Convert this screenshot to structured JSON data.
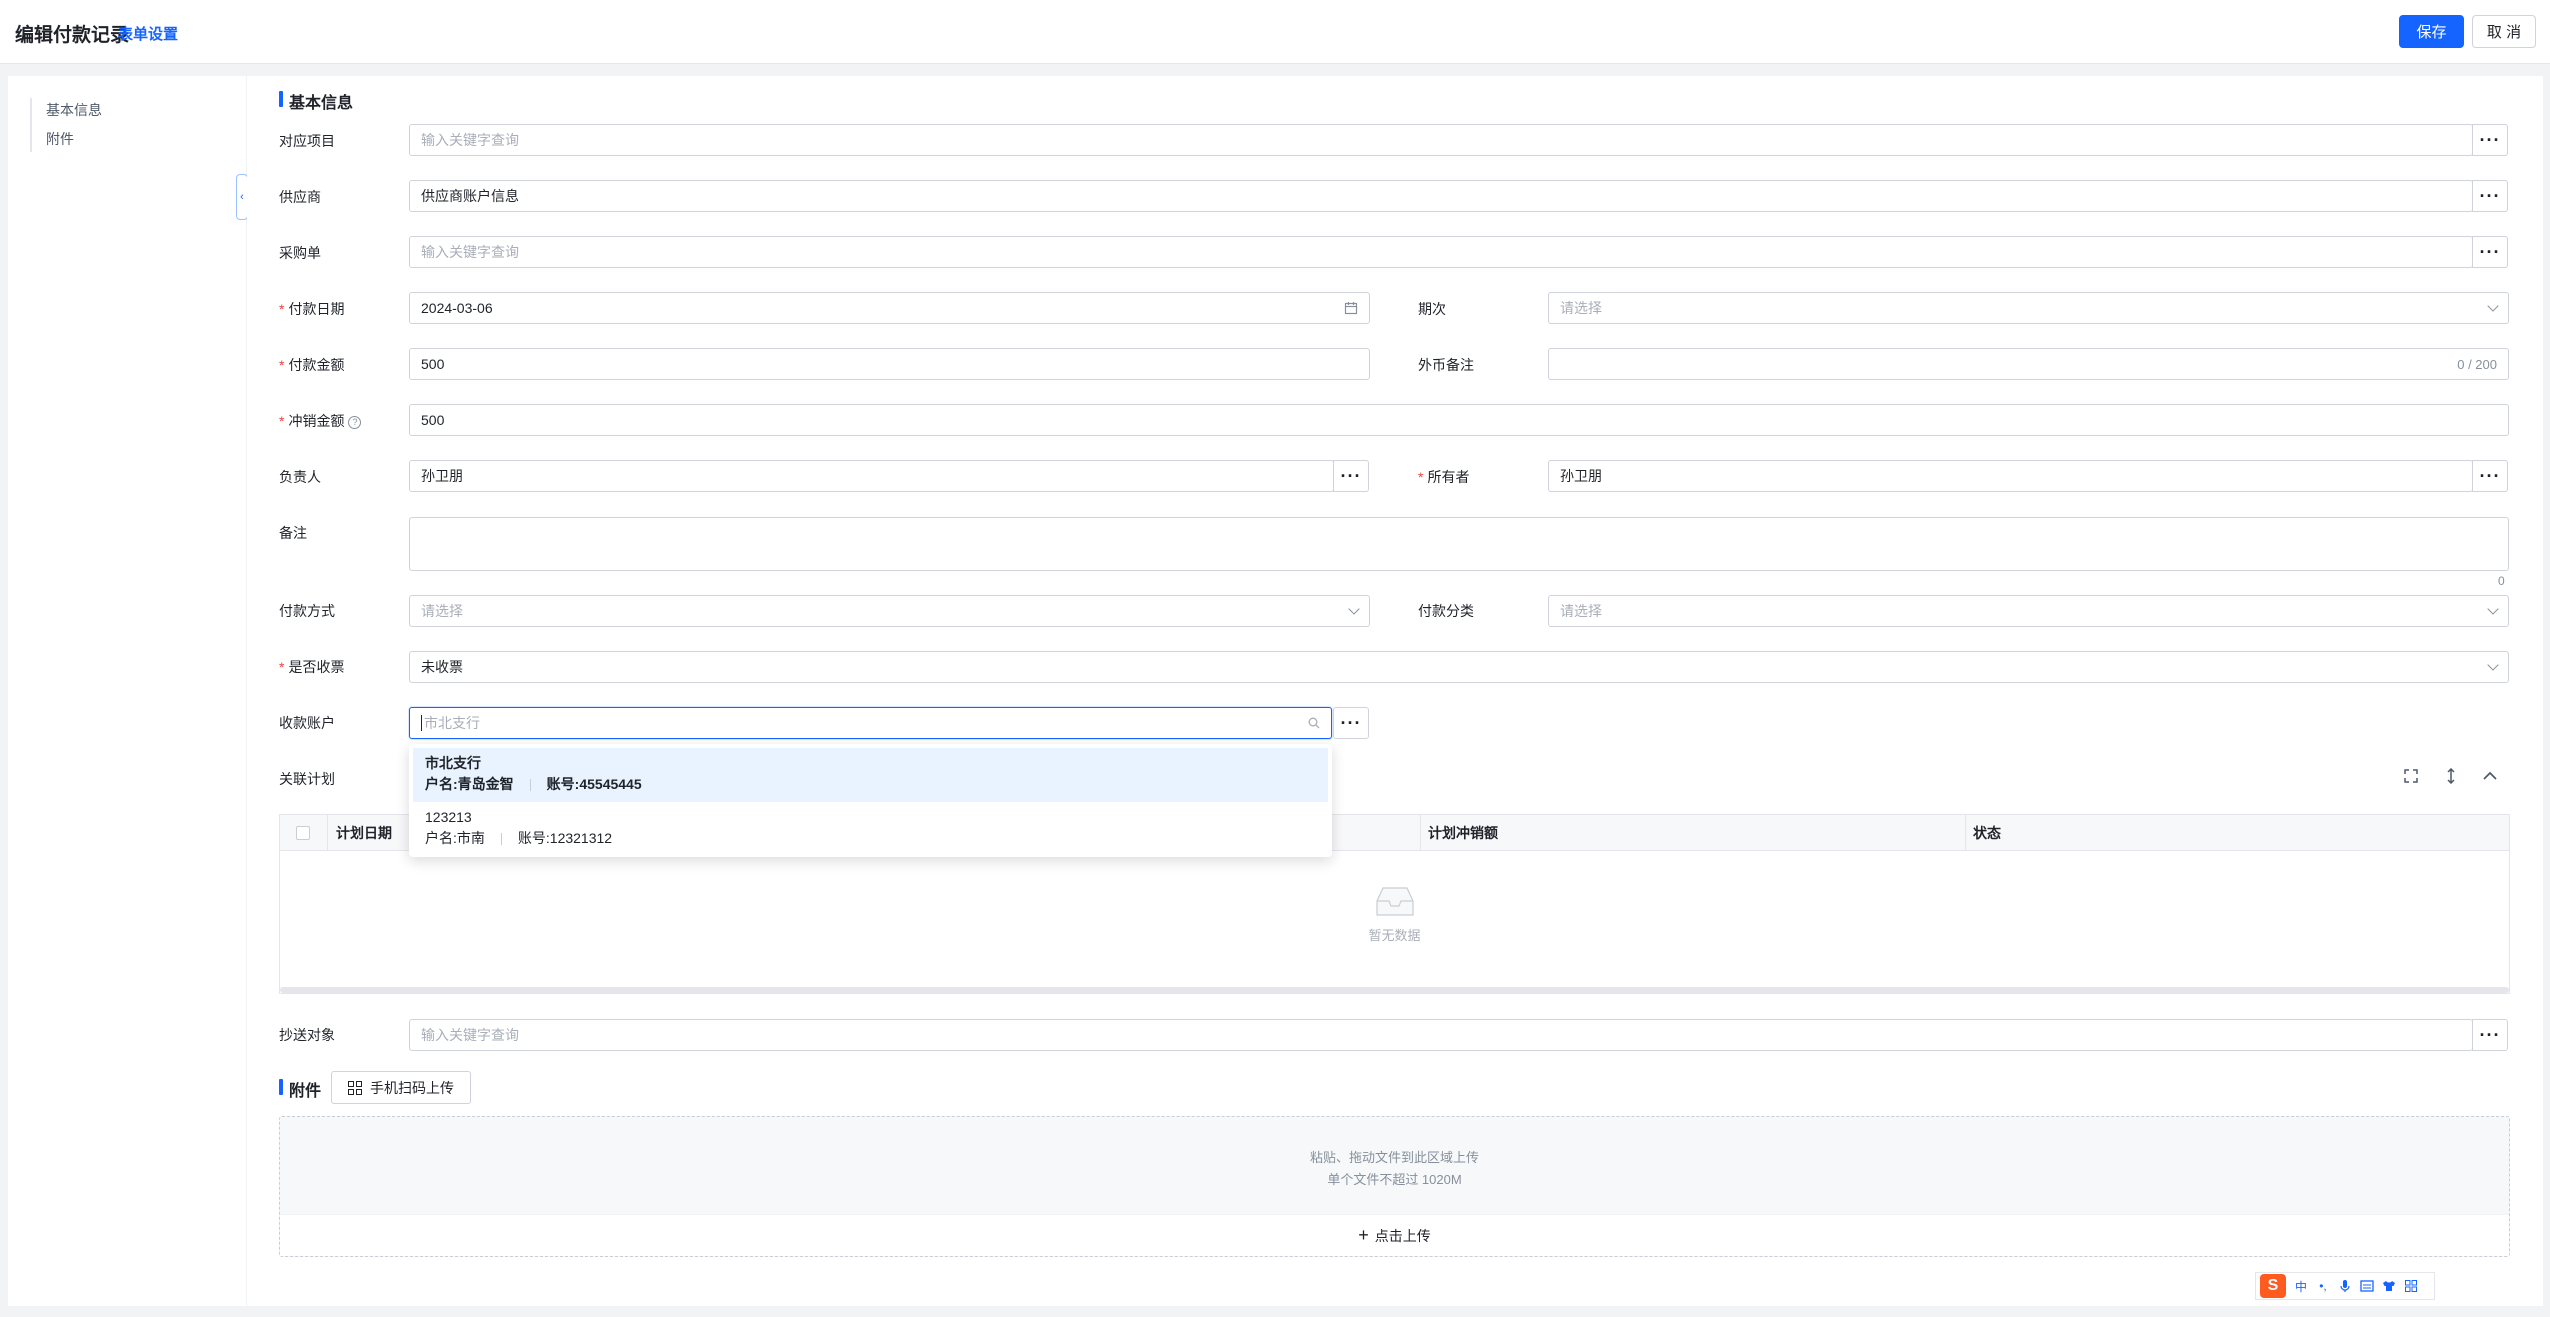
{
  "header": {
    "title": "编辑付款记录",
    "form_settings": "表单设置",
    "save_label": "保存",
    "cancel_label": "取 消"
  },
  "nav": {
    "items": [
      {
        "label": "基本信息"
      },
      {
        "label": "附件"
      }
    ]
  },
  "sections": {
    "basic": "基本信息",
    "plan": "关联计划",
    "attachments": "附件"
  },
  "form": {
    "project": {
      "label": "对应项目",
      "placeholder": "输入关键字查询"
    },
    "supplier": {
      "label": "供应商",
      "value": "供应商账户信息"
    },
    "purchase_order": {
      "label": "采购单",
      "placeholder": "输入关键字查询"
    },
    "pay_date": {
      "label": "付款日期",
      "value": "2024-03-06"
    },
    "period": {
      "label": "期次",
      "placeholder": "请选择"
    },
    "pay_amount": {
      "label": "付款金额",
      "value": "500"
    },
    "fx_note": {
      "label": "外币备注",
      "counter": "0 / 200"
    },
    "offset_amount": {
      "label": "冲销金额",
      "value": "500",
      "help": "?"
    },
    "owner_person": {
      "label": "负责人",
      "value": "孙卫朋"
    },
    "owner": {
      "label": "所有者",
      "value": "孙卫朋"
    },
    "remark": {
      "label": "备注",
      "counter": "0"
    },
    "pay_method": {
      "label": "付款方式",
      "placeholder": "请选择"
    },
    "pay_category": {
      "label": "付款分类",
      "placeholder": "请选择"
    },
    "invoice_received": {
      "label": "是否收票",
      "value": "未收票"
    },
    "receiving_account": {
      "label": "收款账户",
      "placeholder": "市北支行"
    },
    "cc": {
      "label": "抄送对象",
      "placeholder": "输入关键字查询"
    }
  },
  "account_dropdown": [
    {
      "name": "市北支行",
      "holder": "户名:青岛金智",
      "account": "账号:45545445"
    },
    {
      "name": "123213",
      "holder": "户名:市南",
      "account": "账号:12321312"
    }
  ],
  "plan_table": {
    "columns": [
      "计划日期",
      "计划冲销额",
      "状态"
    ],
    "empty_text": "暂无数据"
  },
  "upload": {
    "qr_button": "手机扫码上传",
    "hint_line1": "粘贴、拖动文件到此区域上传",
    "hint_line2": "单个文件不超过 1020M",
    "click_upload": "点击上传"
  },
  "ime": {
    "mode": "中",
    "punct": "•,"
  },
  "colors": {
    "accent": "#1664ff",
    "required": "#f53f3f",
    "border": "#d0d3d9"
  }
}
